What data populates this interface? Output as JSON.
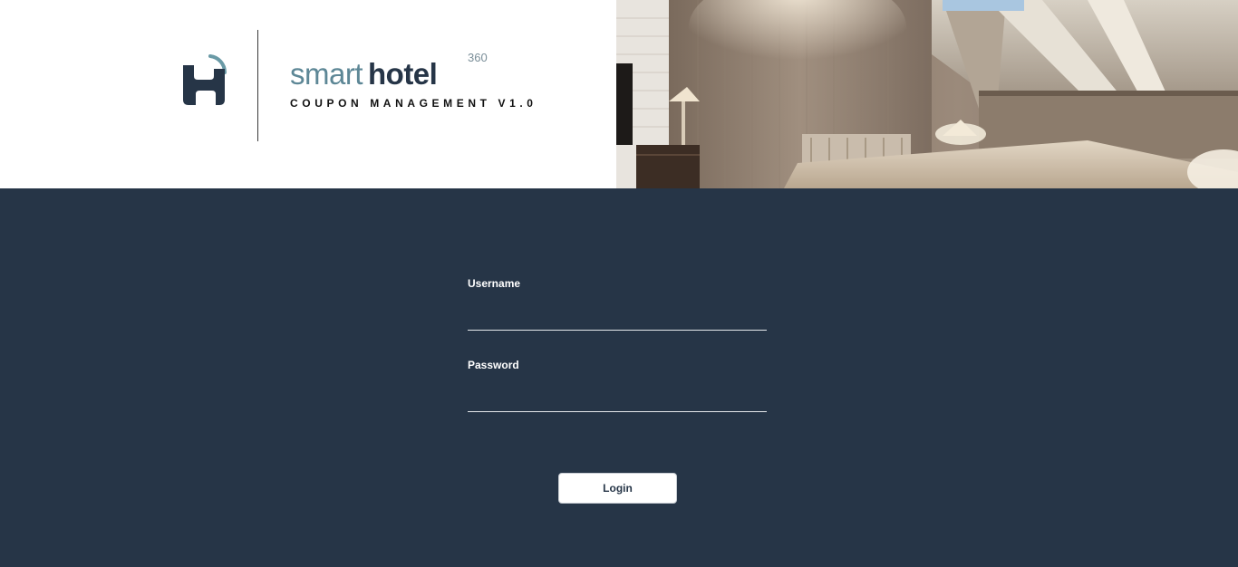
{
  "header": {
    "brand_word_light": "smart",
    "brand_word_bold": "hotel",
    "brand_superscript": "360",
    "subtitle": "COUPON MANAGEMENT V1.0",
    "logo_icon": "smarthotel-logo-icon",
    "photo": "hotel-room-photo"
  },
  "login": {
    "username_label": "Username",
    "username_value": "",
    "password_label": "Password",
    "password_value": "",
    "button_label": "Login"
  },
  "colors": {
    "background": "#263547",
    "brand_light": "#5d8796",
    "brand_dark": "#263547",
    "button_bg": "#ffffff"
  }
}
